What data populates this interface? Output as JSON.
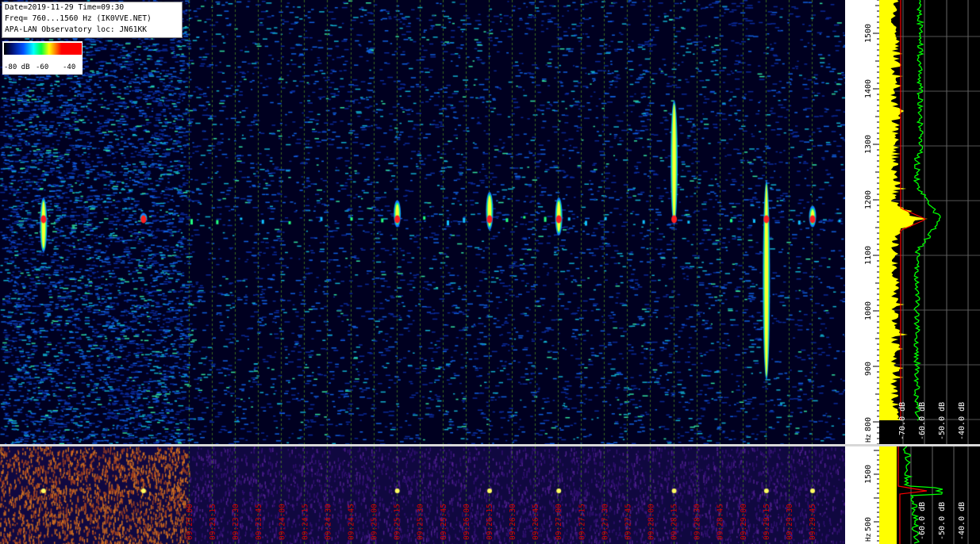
{
  "info": {
    "date_line": "Date=2019-11-29 Time=09:30",
    "freq_line": "Freq= 760...1560 Hz (IK0VVE.NET)",
    "loc_line": "APA-LAN Observatory loc: JN61KK"
  },
  "scale_labels": {
    "low": "-80 dB",
    "mid": "-60",
    "high": "-40"
  },
  "chart_data": [
    {
      "type": "heatmap",
      "title": "",
      "xlabel": "",
      "ylabel": "Hz",
      "ylim": [
        760,
        1560
      ],
      "yticks": [
        800,
        900,
        1000,
        1100,
        1200,
        1300,
        1400,
        1500
      ],
      "y_unit_label": "Hz",
      "x_time_labels": [
        "09:23:00",
        "09:23:15",
        "09:23:30",
        "09:23:45",
        "09:24:00",
        "09:24:15",
        "09:24:30",
        "09:24:45",
        "09:25:00",
        "09:25:15",
        "09:25:30",
        "09:25:45",
        "09:26:00",
        "09:26:15",
        "09:26:30",
        "09:26:45",
        "09:27:00",
        "09:27:15",
        "09:27:30",
        "09:27:45",
        "09:28:00",
        "09:28:15",
        "09:28:30",
        "09:28:45",
        "09:29:00",
        "09:29:15",
        "09:29:30",
        "09:29:45"
      ],
      "colorscale": {
        "min_db": -80,
        "max_db": -40
      },
      "carrier_hz": 1165,
      "events": [
        {
          "time": "09:21:25",
          "f_low": 1110,
          "f_high": 1200
        },
        {
          "time": "09:22:30",
          "f_low": 1165,
          "f_high": 1170
        },
        {
          "time": "09:25:15",
          "f_low": 1155,
          "f_high": 1195
        },
        {
          "time": "09:26:15",
          "f_low": 1150,
          "f_high": 1210
        },
        {
          "time": "09:27:00",
          "f_low": 1140,
          "f_high": 1200
        },
        {
          "time": "09:28:15",
          "f_low": 1160,
          "f_high": 1375
        },
        {
          "time": "09:29:15",
          "f_low": 880,
          "f_high": 1230
        },
        {
          "time": "09:29:45",
          "f_low": 1155,
          "f_high": 1185
        }
      ]
    },
    {
      "type": "line",
      "title": "",
      "series_colors": {
        "yellow": "#ffff00",
        "green": "#00ff00",
        "red": "#ff0000"
      },
      "db_ticks": [
        "-70.0 dB",
        "-60.0 dB",
        "-50.0 dB",
        "-40.0 dB"
      ]
    },
    {
      "type": "heatmap",
      "title": "",
      "yticks": [
        500,
        1500
      ],
      "y_unit_label": "Hz"
    },
    {
      "type": "line",
      "title": "",
      "db_ticks": [
        "-60.0 dB",
        "-50.0 dB",
        "-40.0 dB"
      ]
    }
  ]
}
